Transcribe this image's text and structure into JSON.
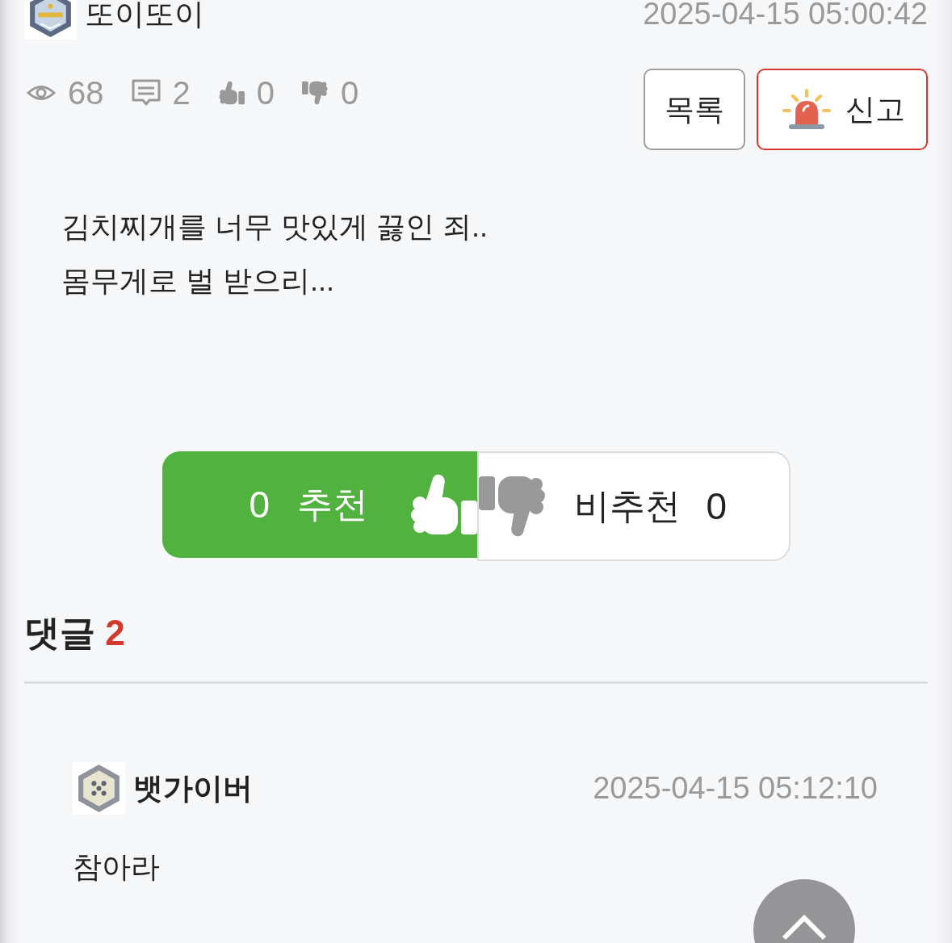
{
  "post": {
    "author": "또이또이",
    "date": "2025-04-15 05:00:42",
    "stats": [
      {
        "kind": "views",
        "value": "68"
      },
      {
        "kind": "comments",
        "value": "2"
      },
      {
        "kind": "likes",
        "value": "0"
      },
      {
        "kind": "dislikes",
        "value": "0"
      }
    ],
    "buttons": [
      {
        "kind": "list",
        "label": "목록"
      },
      {
        "kind": "report",
        "label": "신고"
      }
    ],
    "body": [
      "김치찌개를 너무 맛있게 끓인 죄..",
      "몸무게로 벌 받으리..."
    ]
  },
  "vote": {
    "like": {
      "count": "0",
      "label": "추천"
    },
    "dislike": {
      "label": "비추천",
      "count": "0"
    }
  },
  "comments": {
    "title": "댓글",
    "count": "2",
    "items": [
      {
        "author": "뱃가이버",
        "date": "2025-04-15 05:12:10",
        "text": "참아라"
      }
    ]
  }
}
